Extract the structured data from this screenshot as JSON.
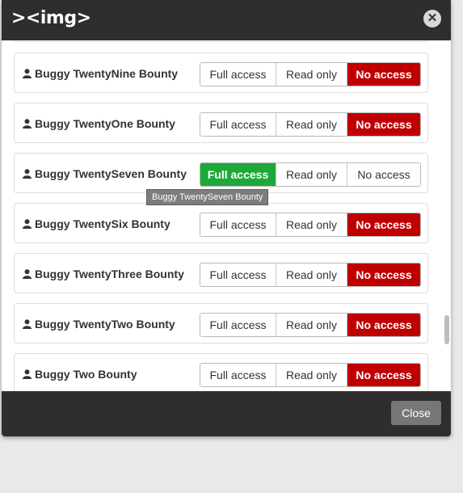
{
  "header": {
    "logo": "><img>",
    "close_symbol": "✕"
  },
  "tooltip": "Buggy TwentySeven Bounty",
  "access_options": [
    "Full access",
    "Read only",
    "No access"
  ],
  "rows": [
    {
      "name": "Buggy TwentyNine Bounty",
      "selected": "No access"
    },
    {
      "name": "Buggy TwentyOne Bounty",
      "selected": "No access"
    },
    {
      "name": "Buggy TwentySeven Bounty",
      "selected": "Full access"
    },
    {
      "name": "Buggy TwentySix Bounty",
      "selected": "No access"
    },
    {
      "name": "Buggy TwentyThree Bounty",
      "selected": "No access"
    },
    {
      "name": "Buggy TwentyTwo Bounty",
      "selected": "No access"
    },
    {
      "name": "Buggy Two Bounty",
      "selected": "No access"
    }
  ],
  "footer": {
    "close_label": "Close"
  },
  "colors": {
    "no_access": "#c00000",
    "full_access": "#1fa83a",
    "header_bg": "#2e2e2e"
  }
}
